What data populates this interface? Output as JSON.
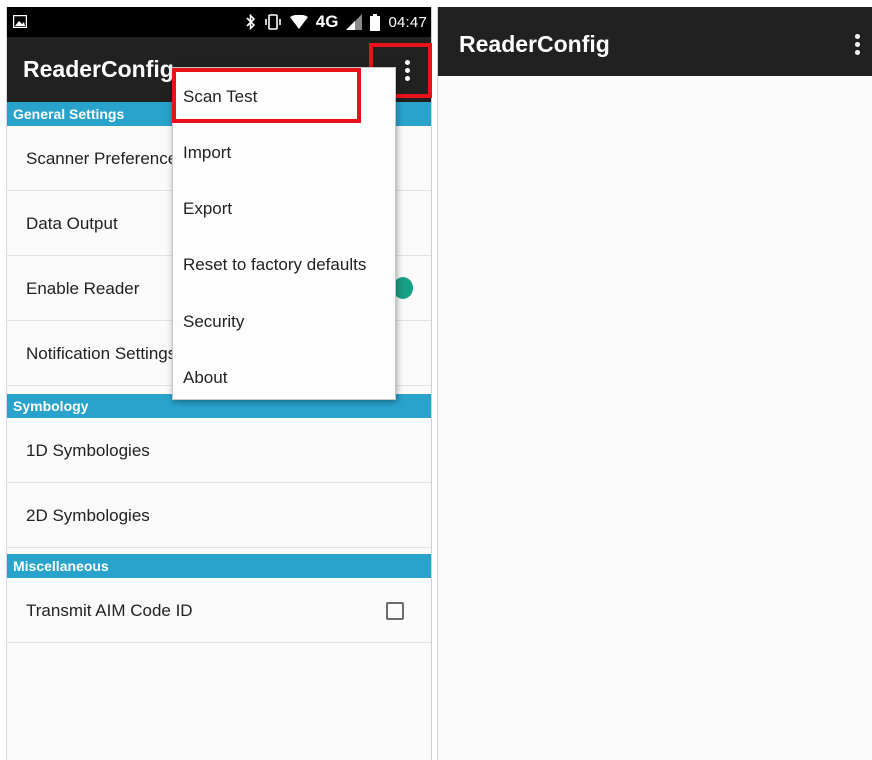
{
  "status_bar": {
    "network": "4G",
    "time": "04:47",
    "icons": [
      "gallery-icon",
      "bluetooth-icon",
      "vibrate-icon",
      "wifi-icon",
      "signal-icon",
      "battery-icon"
    ]
  },
  "app": {
    "title": "ReaderConfig",
    "accent_color": "#29a3cc",
    "toolbar_color": "#212121",
    "highlight_color": "#e8121a",
    "toggle_color": "#16a085"
  },
  "sections": {
    "general": {
      "header": "General Settings",
      "items": [
        "Scanner Preferences",
        "Data Output",
        "Enable Reader",
        "Notification Settings"
      ]
    },
    "symbology": {
      "header": "Symbology",
      "items": [
        "1D Symbologies",
        "2D Symbologies"
      ]
    },
    "misc": {
      "header": "Miscellaneous",
      "items": [
        "Transmit AIM Code ID"
      ]
    }
  },
  "menu": {
    "items": [
      "Scan Test",
      "Import",
      "Export",
      "Reset to factory defaults",
      "Security",
      "About"
    ]
  },
  "right_screen": {
    "title": "ReaderConfig"
  }
}
